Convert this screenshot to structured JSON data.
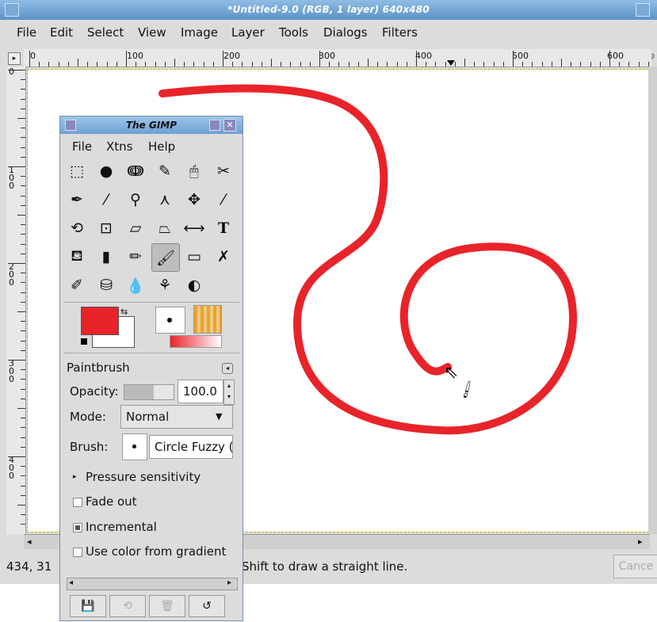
{
  "window": {
    "title": "*Untitled-9.0 (RGB, 1 layer) 640x480",
    "menu": [
      "File",
      "Edit",
      "Select",
      "View",
      "Image",
      "Layer",
      "Tools",
      "Dialogs",
      "Filters"
    ],
    "ruler_top_labels": [
      "0",
      "100",
      "200",
      "300",
      "400",
      "500",
      "600"
    ],
    "ruler_left_labels": [
      "0",
      "1\n0\n0",
      "2\n0\n0",
      "3\n0\n0",
      "4\n0\n0"
    ],
    "status": {
      "coords": "434, 31",
      "hint": "Shift to draw a straight line.",
      "cancel": "Cance"
    }
  },
  "stroke_color": "#e8242a",
  "toolbox": {
    "title": "The GIMP",
    "menu": [
      "File",
      "Xtns",
      "Help"
    ],
    "tools": [
      [
        "rect-select-icon",
        "ellipse-select-icon",
        "free-select-icon",
        "fuzzy-select-icon",
        "color-select-icon",
        "scissors-icon"
      ],
      [
        "paths-icon",
        "color-picker-icon",
        "zoom-icon",
        "measure-icon",
        "move-icon",
        "crop-icon"
      ],
      [
        "rotate-icon",
        "scale-icon",
        "shear-icon",
        "perspective-icon",
        "flip-icon",
        "text-icon"
      ],
      [
        "bucket-fill-icon",
        "blend-icon",
        "pencil-icon",
        "paintbrush-icon",
        "eraser-icon",
        "airbrush-icon"
      ],
      [
        "ink-icon",
        "clone-icon",
        "blur-icon",
        "smudge-icon",
        "dodge-burn-icon"
      ]
    ],
    "tool_glyphs": [
      [
        "⬚",
        "●",
        "ↈ",
        "✎",
        "🖱",
        "✂"
      ],
      [
        "✒",
        "⁄",
        "⚲",
        "⋏",
        "✥",
        "⁄"
      ],
      [
        "⟲",
        "⊡",
        "▱",
        "⏢",
        "⟷",
        "T"
      ],
      [
        "⛾",
        "▮",
        "✏",
        "🖌",
        "▭",
        "✗"
      ],
      [
        "✐",
        "⛁",
        "💧",
        "⚘",
        "◐"
      ]
    ],
    "fg_color": "#e8242a",
    "bg_color": "#ffffff",
    "tool_options": {
      "title": "Paintbrush",
      "opacity_label": "Opacity:",
      "opacity_value": "100.0",
      "mode_label": "Mode:",
      "mode_value": "Normal",
      "brush_label": "Brush:",
      "brush_value": "Circle Fuzzy (",
      "pressure": "Pressure sensitivity",
      "fade_out": "Fade out",
      "incremental": "Incremental",
      "use_gradient": "Use color from gradient"
    }
  }
}
